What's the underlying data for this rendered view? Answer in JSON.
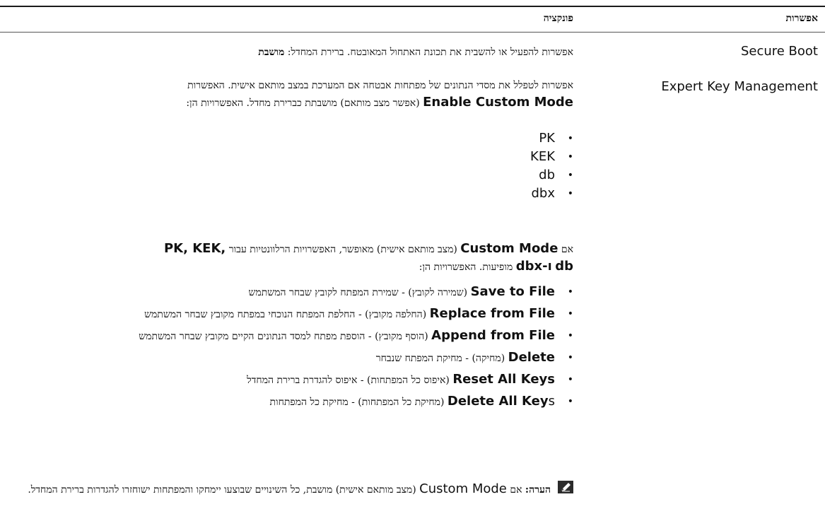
{
  "header": {
    "col_option": "אפשרות",
    "col_function": "פונקציה"
  },
  "rows": [
    {
      "option": "Secure Boot",
      "description": "אפשרות להפעיל או להשבית את תכונת האתחול המאובטח. ברירת המחדל:",
      "default_value": "מושבת"
    },
    {
      "option": "Expert Key Management",
      "intro_line1": "אפשרות לטפלל את מסדי הנתונים של מפתחות אבטחה אם המערכת במצב מותאם אישית. האפשרות",
      "intro_enable": "Enable Custom Mode",
      "intro_rest": "(אפשר מצב מותאם) מושבתת כברירת מחדל. האפשרויות הן:",
      "key_dbs": [
        "PK",
        "KEK",
        "db",
        "dbx"
      ],
      "custom_if": "אם",
      "custom_mode": "Custom Mode",
      "custom_mid": "(מצב מותאם אישית) מאופשר, האפשרויות הרלוונטיות עבור",
      "custom_keys": "PK, KEK,",
      "custom_db": "db",
      "custom_and": "ו-dbx",
      "custom_end": "מופיעות. האפשרויות הן:",
      "actions": [
        {
          "name": "Save to File",
          "text": "(שמירה לקובץ) - שמירת המפתח לקובץ שבחר המשתמש"
        },
        {
          "name": "Replace from File",
          "text": "(החלפה מקובץ) - החלפת המפתח הנוכחי במפתח מקובץ שבחר המשתמש"
        },
        {
          "name": "Append from File",
          "text": "(הוסף מקובץ) - הוספת מפתח למסד הנתונים הקיים מקובץ שבחר המשתמש"
        },
        {
          "name": "Delete",
          "text": "(מחיקה) - מחיקת המפתח שנבחר"
        },
        {
          "name": "Reset All Keys",
          "text": "(איפוס כל המפתחות) - איפוס להגדרת ברירת המחדל"
        },
        {
          "name": "Delete All Key",
          "suffix": "s",
          "text": "(מחיקת כל המפתחות) - מחיקת כל המפתחות"
        }
      ],
      "note_label": "הערה:",
      "note_if": "אם",
      "note_mode": "Custom Mode",
      "note_text": "(מצב מותאם אישית) מושבת, כל השינויים שבוצעו יימחקו והמפתחות ישוחזרו להגדרות ברירת המחדל."
    }
  ],
  "icons": {
    "note": "note-pencil-icon"
  }
}
